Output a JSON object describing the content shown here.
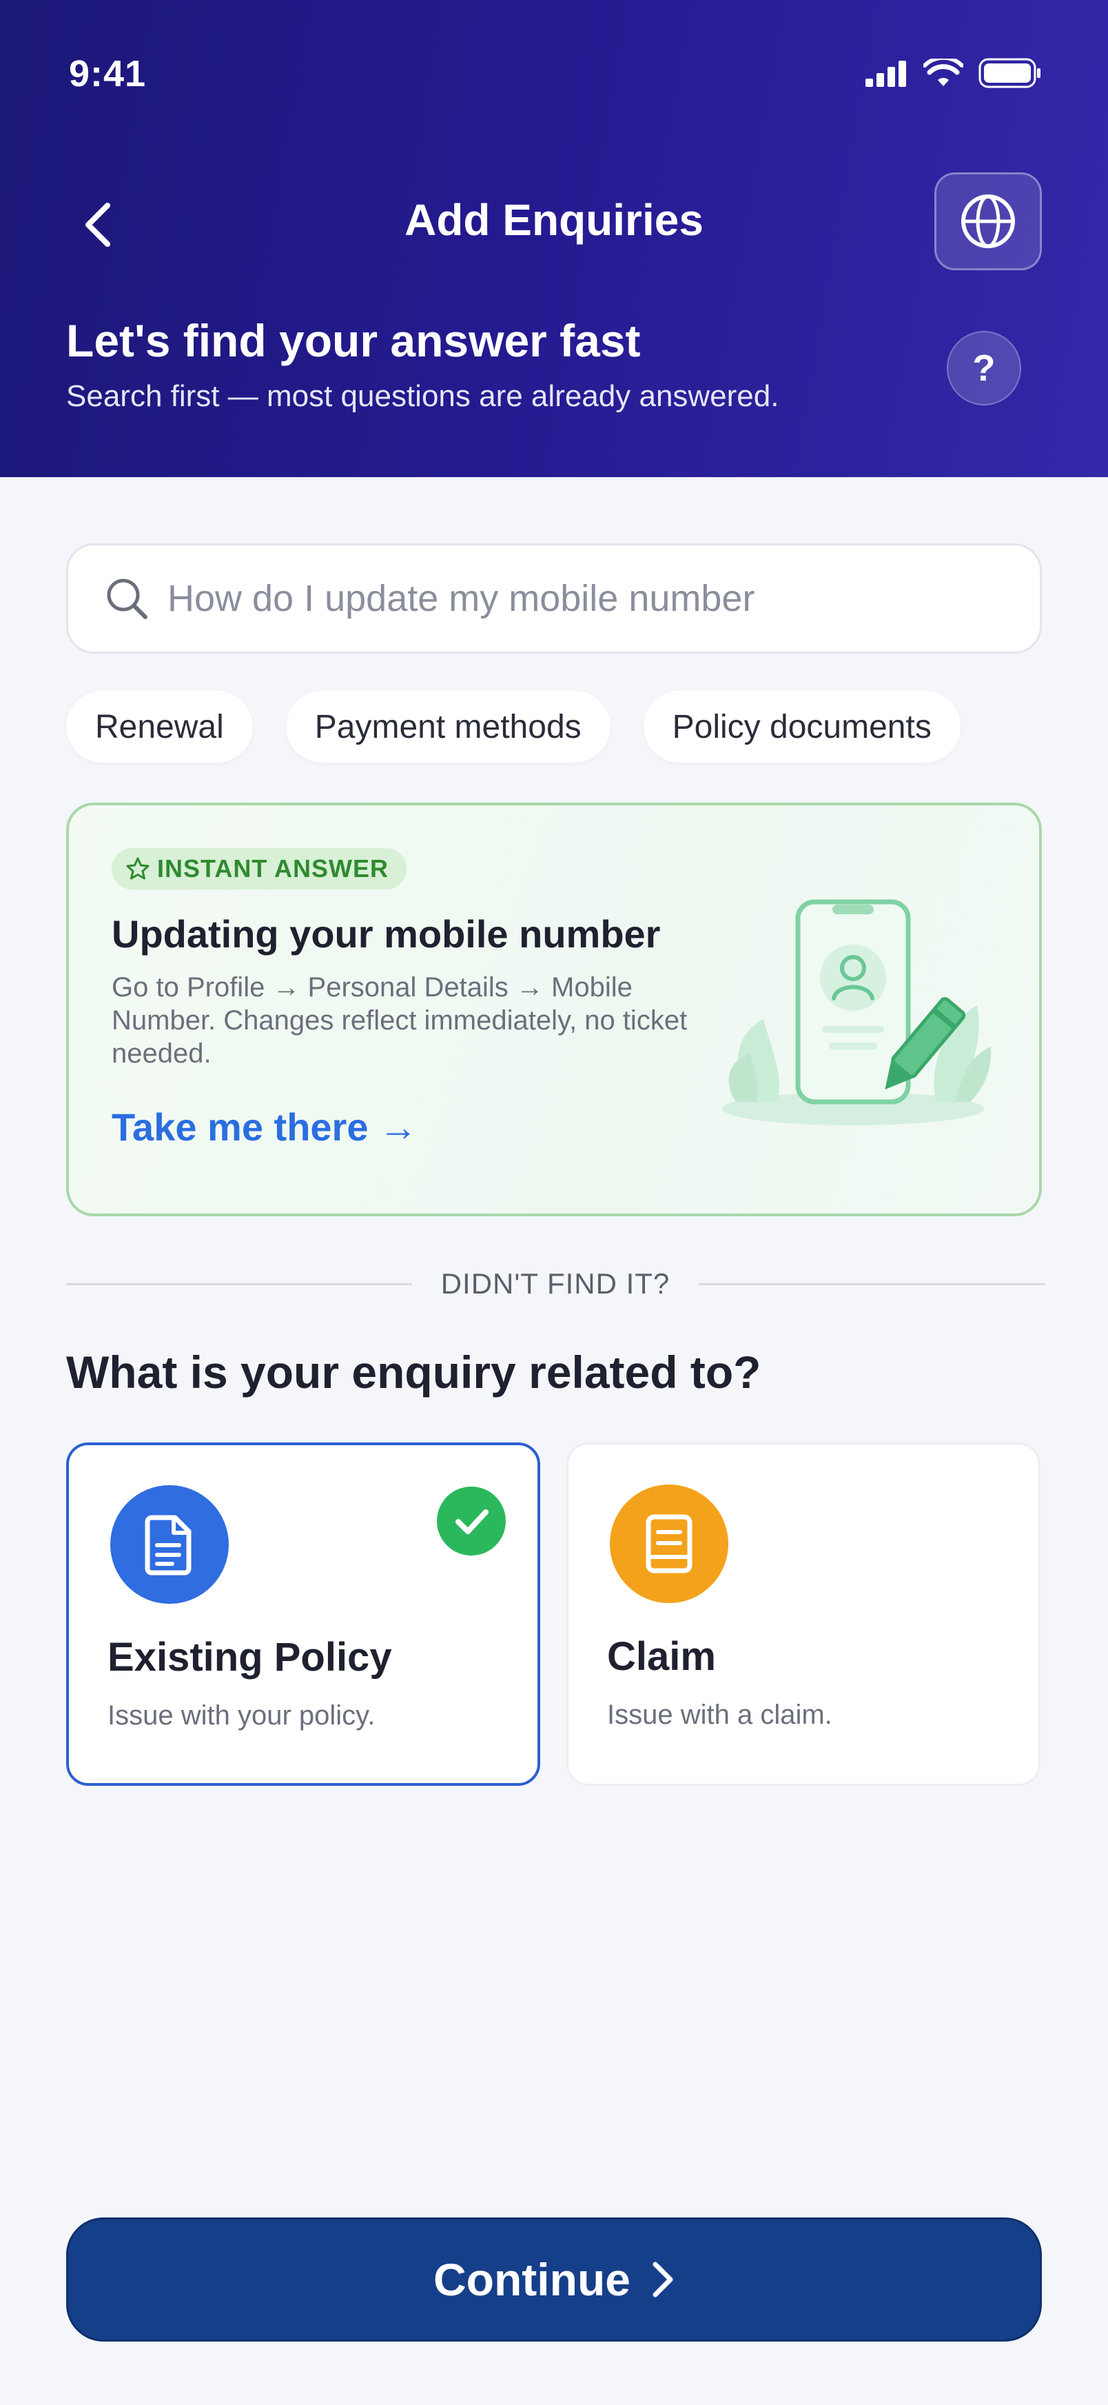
{
  "status_bar": {
    "time": "9:41"
  },
  "nav": {
    "title": "Add Enquiries"
  },
  "hero": {
    "title": "Let's find your answer fast",
    "subtitle": "Search first — most questions are already answered.",
    "help_label": "?"
  },
  "search": {
    "placeholder": "How do I update my mobile number",
    "value": ""
  },
  "chips": [
    "Renewal",
    "Payment methods",
    "Policy documents"
  ],
  "answer_card": {
    "badge": "INSTANT ANSWER",
    "title": "Updating your mobile number",
    "body": "Go to Profile → Personal Details → Mobile Number. Changes reflect immediately, no ticket needed.",
    "link": "Take me there →"
  },
  "divider": {
    "text": "DIDN'T FIND IT?"
  },
  "section": {
    "title": "What is your enquiry related to?"
  },
  "options": [
    {
      "title": "Existing Policy",
      "subtitle": "Issue with your policy.",
      "selected": true,
      "icon": "document-icon",
      "color": "#2f6de0"
    },
    {
      "title": "Claim",
      "subtitle": "Issue with a claim.",
      "selected": false,
      "icon": "book-icon",
      "color": "#f4a21b"
    }
  ],
  "continue": {
    "label": "Continue"
  },
  "colors": {
    "header_gradient_start": "#1c1878",
    "header_gradient_end": "#3328a8",
    "accent_blue": "#2a6ee0",
    "success_green": "#2bb85c",
    "primary_button": "#163f8a"
  }
}
